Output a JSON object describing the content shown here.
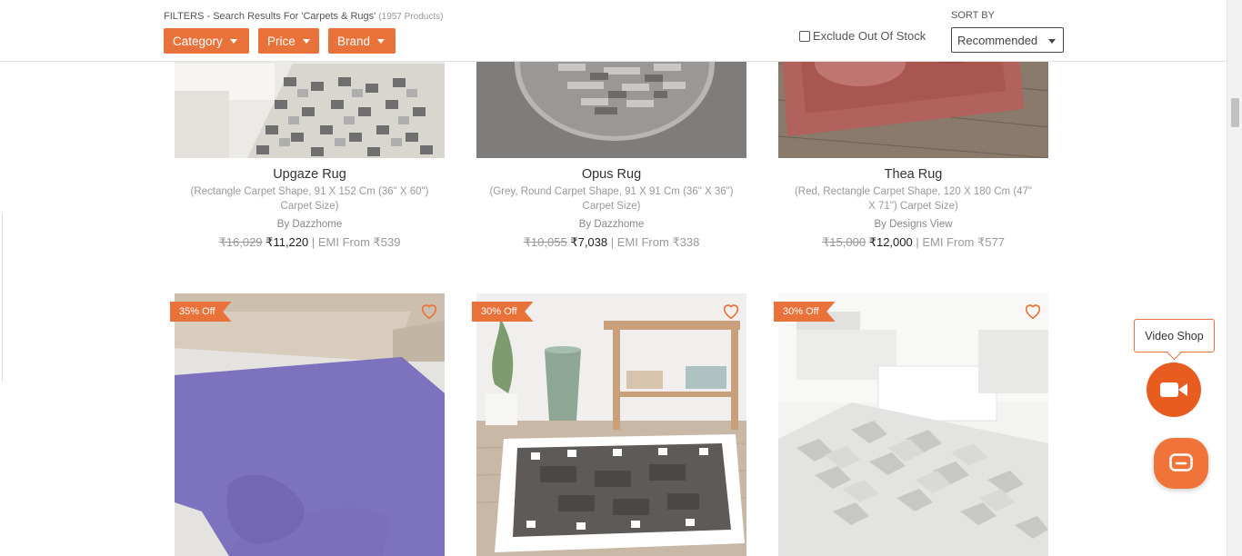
{
  "filters": {
    "title": "FILTERS - Search Results For 'Carpets & Rugs'",
    "count": "(1957 Products)",
    "buttons": [
      "Category",
      "Price",
      "Brand"
    ],
    "exclude_label": "Exclude Out Of Stock",
    "sort_label": "SORT BY",
    "sort_value": "Recommended"
  },
  "products_row1": [
    {
      "name": "Upgaze Rug",
      "desc": "(Rectangle Carpet Shape, 91 X 152 Cm (36\" X 60\") Carpet Size)",
      "brand": "By Dazzhome",
      "mrp": "₹16,029",
      "price": "₹11,220",
      "emi": " | EMI From ₹539"
    },
    {
      "name": "Opus Rug",
      "desc": "(Grey, Round Carpet Shape, 91 X 91 Cm (36\" X 36\") Carpet Size)",
      "brand": "By Dazzhome",
      "mrp": "₹10,055",
      "price": "₹7,038",
      "emi": " | EMI From ₹338"
    },
    {
      "name": "Thea Rug",
      "desc": "(Red, Rectangle Carpet Shape, 120 X 180 Cm (47\" X 71\") Carpet Size)",
      "brand": "By Designs View",
      "mrp": "₹15,000",
      "price": "₹12,000",
      "emi": " | EMI From ₹577"
    }
  ],
  "products_row2": [
    {
      "badge": "35% Off"
    },
    {
      "badge": "30% Off"
    },
    {
      "badge": "30% Off"
    }
  ],
  "video_shop": {
    "label": "Video Shop"
  },
  "colors": {
    "accent": "#e9723a"
  }
}
